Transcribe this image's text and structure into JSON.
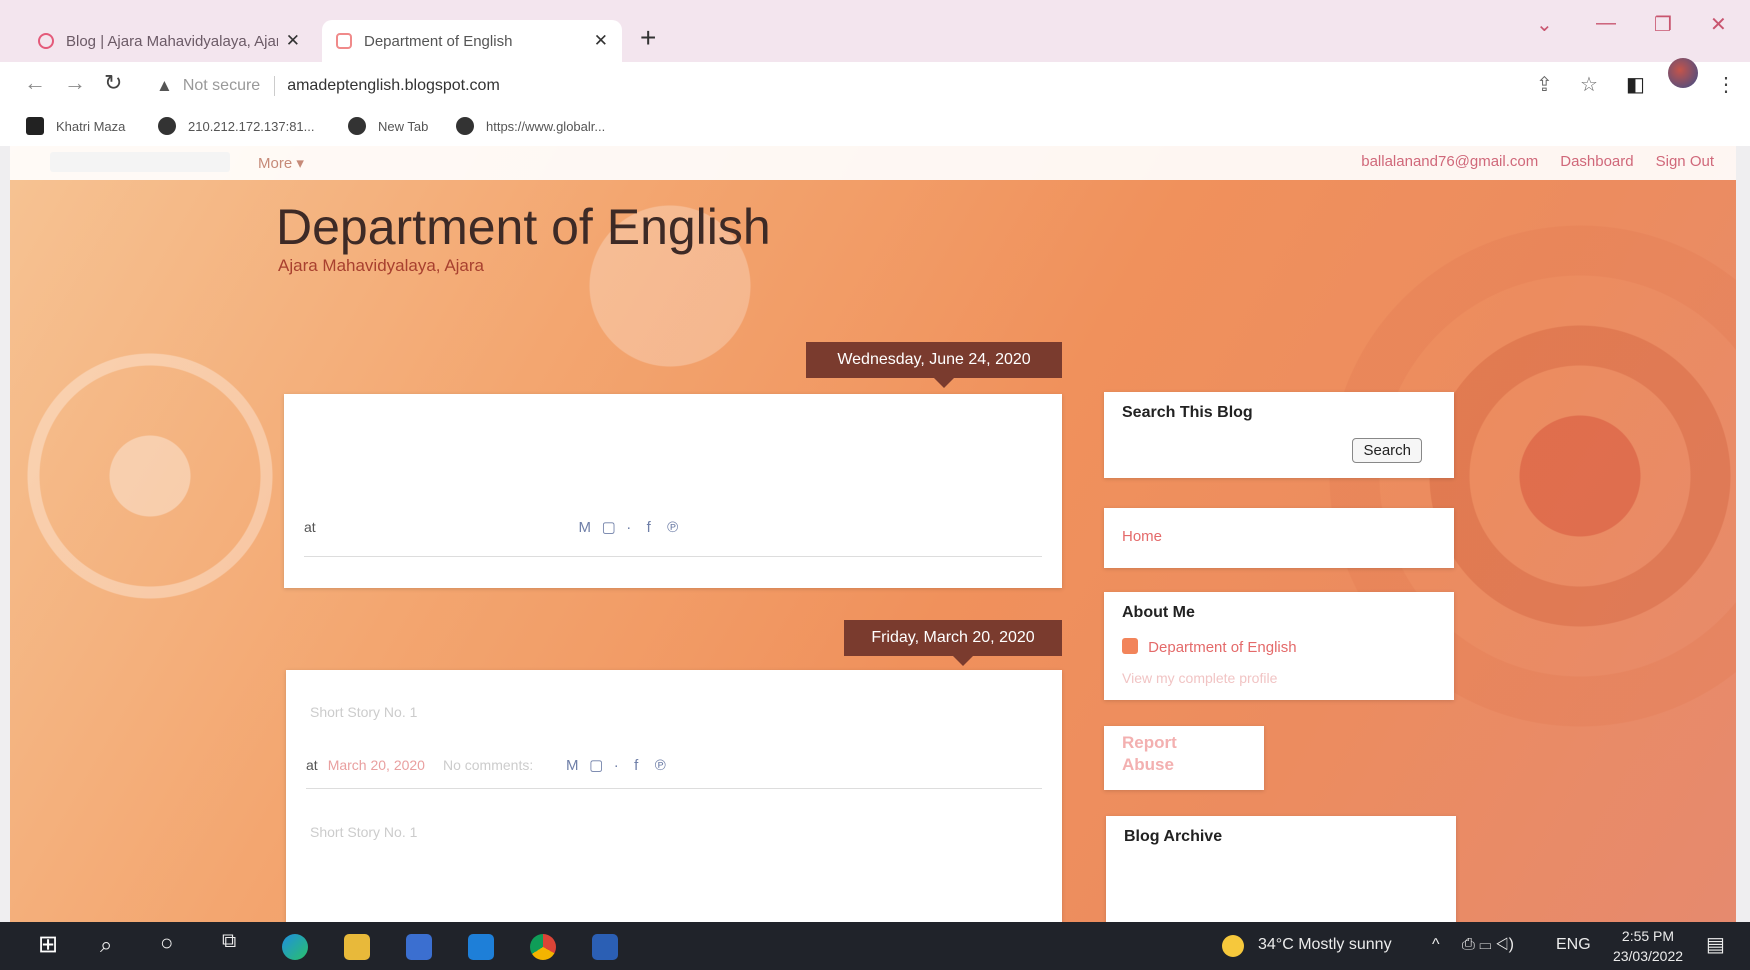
{
  "browser": {
    "tabs": [
      {
        "title": "Blog | Ajara Mahavidyalaya, Ajara",
        "active": false
      },
      {
        "title": "Department of English",
        "active": true
      }
    ],
    "new_tab_symbol": "+",
    "address_bar": {
      "security_label": "Not secure",
      "url": "amadeptenglish.blogspot.com"
    },
    "bookmarks": [
      "Khatri Maza",
      "210.212.172.137:81...",
      "New Tab",
      "https://www.globalr..."
    ]
  },
  "blogger_navbar": {
    "more_label": "More ▾",
    "email": "ballalanand76@gmail.com",
    "dashboard_label": "Dashboard",
    "signout_label": "Sign Out"
  },
  "blog": {
    "title": "Department of English",
    "description": "Ajara Mahavidyalaya, Ajara",
    "posts": [
      {
        "date": "Wednesday, June 24, 2020",
        "body_text": "",
        "at_label": "at",
        "time": "",
        "comments": ""
      },
      {
        "date": "Friday, March 20, 2020",
        "body_text": "Short Story No. 1",
        "at_label": "at",
        "time": "March 20, 2020",
        "comments": "No comments:",
        "next_body": "Short Story No. 1"
      }
    ]
  },
  "sidebar": {
    "search_widget": {
      "title": "Search This Blog",
      "button_label": "Search"
    },
    "pages_widget": {
      "home_label": "Home"
    },
    "about_widget": {
      "title": "About Me",
      "profile_name": "Department of English",
      "profile_link": "View my complete profile"
    },
    "report_abuse": {
      "line1": "Report",
      "line2": "Abuse"
    },
    "archive_widget": {
      "title": "Blog Archive"
    }
  },
  "taskbar": {
    "weather": "34°C  Mostly sunny",
    "language": "ENG",
    "time": "2:55 PM",
    "date": "23/03/2022"
  },
  "colors": {
    "date_header": "#7a3b2e",
    "link_pink": "#e46a6a",
    "taskbar": "#20232a",
    "accent_tab": "#f3e5ee"
  }
}
